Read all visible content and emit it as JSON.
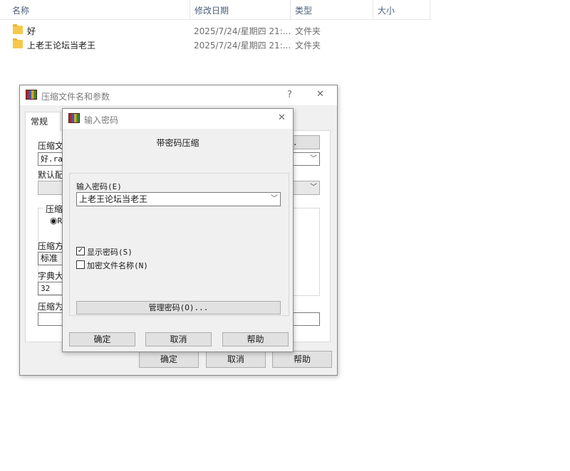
{
  "explorer": {
    "columns": {
      "name": "名称",
      "modified": "修改日期",
      "type": "类型",
      "size": "大小"
    },
    "sort_glyph": "^",
    "rows": [
      {
        "name": "好",
        "modified": "2025/7/24/星期四 21:...",
        "type": "文件夹"
      },
      {
        "name": "上老王论坛当老王",
        "modified": "2025/7/24/星期四 21:...",
        "type": "文件夹"
      }
    ]
  },
  "archive_dialog": {
    "title": "压缩文件名和参数",
    "help_glyph": "?",
    "close_glyph": "✕",
    "tab_general": "常规",
    "archive_name_label": "压缩文",
    "archive_name_value": "好.rar",
    "browse_button": "B)...",
    "default_profile_label": "默认配",
    "format_label": "压缩文",
    "format_option": "R",
    "method_label": "压缩方",
    "method_value": "标准",
    "dict_label": "字典大",
    "dict_value": "32",
    "split_label": "压缩为",
    "ok_button": "确定",
    "cancel_button": "取消",
    "help_button": "帮助"
  },
  "password_dialog": {
    "title": "输入密码",
    "close_glyph": "✕",
    "heading": "带密码压缩",
    "password_label": "输入密码(E)",
    "password_value": "上老王论坛当老王",
    "show_password_label": "显示密码(S)",
    "show_password_checked": true,
    "encrypt_names_label": "加密文件名称(N)",
    "encrypt_names_checked": false,
    "manage_button": "管理密码(O)...",
    "ok_button": "确定",
    "cancel_button": "取消",
    "help_button": "帮助"
  }
}
